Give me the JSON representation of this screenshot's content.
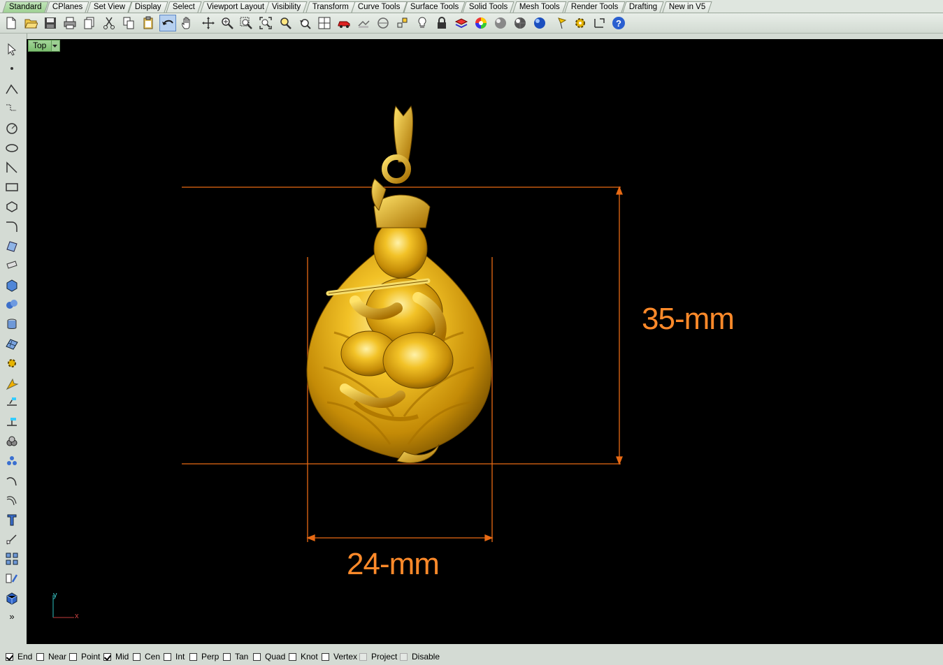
{
  "tabs": [
    {
      "label": "Standard",
      "active": true
    },
    {
      "label": "CPlanes"
    },
    {
      "label": "Set View"
    },
    {
      "label": "Display"
    },
    {
      "label": "Select"
    },
    {
      "label": "Viewport Layout"
    },
    {
      "label": "Visibility"
    },
    {
      "label": "Transform"
    },
    {
      "label": "Curve Tools"
    },
    {
      "label": "Surface Tools"
    },
    {
      "label": "Solid Tools"
    },
    {
      "label": "Mesh Tools"
    },
    {
      "label": "Render Tools"
    },
    {
      "label": "Drafting"
    },
    {
      "label": "New in V5"
    }
  ],
  "toolbar_icons": [
    "new-file-icon",
    "open-folder-icon",
    "save-icon",
    "print-icon",
    "copy-page-icon",
    "cut-icon",
    "copy-icon",
    "paste-icon",
    "undo-icon",
    "pan-hand-icon",
    "rotate-view-icon",
    "zoom-icon",
    "zoom-window-icon",
    "zoom-extents-icon",
    "zoom-selected-icon",
    "undo-view-icon",
    "four-viewports-icon",
    "car-icon",
    "properties-icon",
    "cplane-icon",
    "point-icon",
    "light-icon",
    "lock-icon",
    "layer-icon",
    "color-wheel-icon",
    "shade-icon",
    "render-sphere-icon",
    "blue-sphere-icon",
    "flag-icon",
    "gear-icon",
    "dimension-icon",
    "help-icon"
  ],
  "viewport": {
    "name": "Top",
    "background": "#000000"
  },
  "dimensions": {
    "height": "35-mm",
    "width": "24-mm",
    "color": "#ff8a2a"
  },
  "axis": {
    "x": "x",
    "y": "y"
  },
  "osnap": [
    {
      "label": "End",
      "checked": true
    },
    {
      "label": "Near",
      "checked": false
    },
    {
      "label": "Point",
      "checked": false
    },
    {
      "label": "Mid",
      "checked": true
    },
    {
      "label": "Cen",
      "checked": false
    },
    {
      "label": "Int",
      "checked": false
    },
    {
      "label": "Perp",
      "checked": false
    },
    {
      "label": "Tan",
      "checked": false
    },
    {
      "label": "Quad",
      "checked": false
    },
    {
      "label": "Knot",
      "checked": false
    },
    {
      "label": "Vertex",
      "checked": false
    },
    {
      "label": "Project",
      "checked": false,
      "disabled": true
    },
    {
      "label": "Disable",
      "checked": false,
      "disabled": true
    }
  ],
  "sidebar_expand": "»"
}
